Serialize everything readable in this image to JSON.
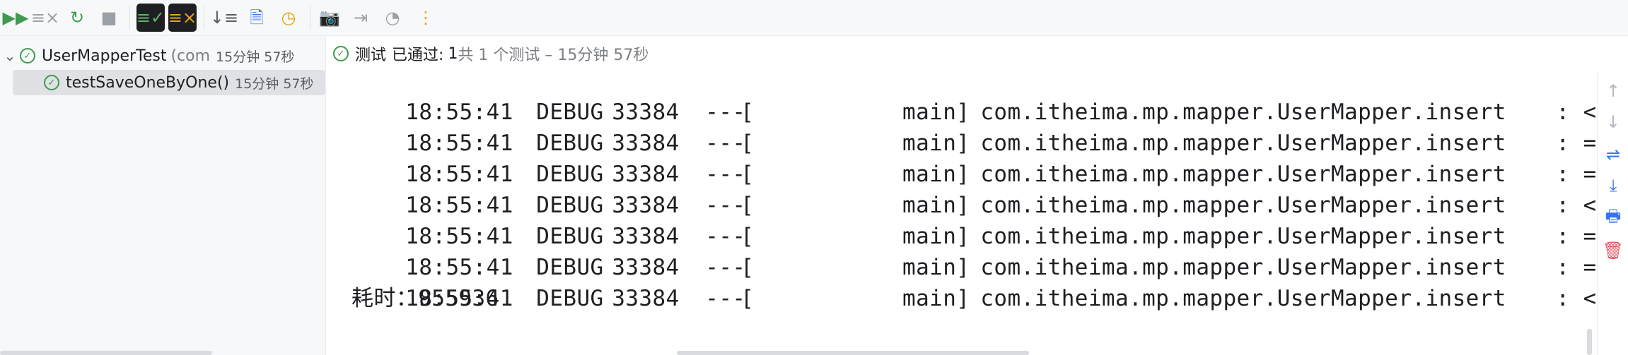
{
  "toolbar": {
    "buttons": [
      {
        "name": "rerun-icon",
        "glyph": "▶▶",
        "color": "#3f9a4e"
      },
      {
        "name": "rerun-failed-icon",
        "glyph": "≡×",
        "color": "#9aa0a6"
      },
      {
        "name": "rerun-refresh-icon",
        "glyph": "↻",
        "color": "#3f9a4e"
      },
      {
        "name": "stop-icon",
        "glyph": "■",
        "color": "#9aa0a6"
      },
      {
        "name": "show-passed-icon",
        "glyph": "≡✓",
        "color": "#5fb865"
      },
      {
        "name": "show-ignored-icon",
        "glyph": "≡×",
        "color": "#e5a50a"
      },
      {
        "name": "sort-icon",
        "glyph": "↓≡",
        "color": "#5a5d63"
      },
      {
        "name": "import-tests-icon",
        "glyph": "🗎",
        "color": "#3574f0"
      },
      {
        "name": "history-icon",
        "glyph": "◷",
        "color": "#e5a50a"
      },
      {
        "name": "screenshot-icon",
        "glyph": "📷",
        "color": "#9aa0a6"
      },
      {
        "name": "export-icon",
        "glyph": "⇥",
        "color": "#9aa0a6"
      },
      {
        "name": "coverage-icon",
        "glyph": "◔",
        "color": "#9aa0a6"
      },
      {
        "name": "more-options-icon",
        "glyph": "⋮",
        "color": "#e5a50a"
      }
    ]
  },
  "tree": {
    "root": {
      "label": "UserMapperTest",
      "package": "(com",
      "duration": "15分钟 57秒"
    },
    "child": {
      "label": "testSaveOneByOne()",
      "duration": "15分钟 57秒"
    }
  },
  "status": {
    "label": "测试",
    "state": "已通过:",
    "passed": "1",
    "summary": "共 1 个测试 – 15分钟 57秒"
  },
  "console": {
    "lines": [
      {
        "ts": "18:55:41",
        "level": "DEBUG",
        "pid": "33384",
        "dash": "---",
        "thread": "[           main]",
        "logger": "com.itheima.mp.mapper.UserMapper.insert",
        "msg": " : <=="
      },
      {
        "ts": "18:55:41",
        "level": "DEBUG",
        "pid": "33384",
        "dash": "---",
        "thread": "[           main]",
        "logger": "com.itheima.mp.mapper.UserMapper.insert",
        "msg": " : ==>  Pr"
      },
      {
        "ts": "18:55:41",
        "level": "DEBUG",
        "pid": "33384",
        "dash": "---",
        "thread": "[           main]",
        "logger": "com.itheima.mp.mapper.UserMapper.insert",
        "msg": " : ==> Par"
      },
      {
        "ts": "18:55:41",
        "level": "DEBUG",
        "pid": "33384",
        "dash": "---",
        "thread": "[           main]",
        "logger": "com.itheima.mp.mapper.UserMapper.insert",
        "msg": " : <=="
      },
      {
        "ts": "18:55:41",
        "level": "DEBUG",
        "pid": "33384",
        "dash": "---",
        "thread": "[           main]",
        "logger": "com.itheima.mp.mapper.UserMapper.insert",
        "msg": " : ==>  Pr"
      },
      {
        "ts": "18:55:41",
        "level": "DEBUG",
        "pid": "33384",
        "dash": "---",
        "thread": "[           main]",
        "logger": "com.itheima.mp.mapper.UserMapper.insert",
        "msg": " : ==> Par"
      },
      {
        "ts": "18:55:41",
        "level": "DEBUG",
        "pid": "33384",
        "dash": "---",
        "thread": "[           main]",
        "logger": "com.itheima.mp.mapper.UserMapper.insert",
        "msg": " : <=="
      }
    ],
    "elapsed": "耗时：955936"
  },
  "gutter": {
    "buttons": [
      {
        "name": "scroll-up-icon",
        "glyph": "↑",
        "color": "#b4b8bf"
      },
      {
        "name": "scroll-down-icon",
        "glyph": "↓",
        "color": "#b4b8bf"
      },
      {
        "name": "soft-wrap-icon",
        "glyph": "⇌",
        "color": "#3574f0"
      },
      {
        "name": "scroll-to-end-icon",
        "glyph": "⤓",
        "color": "#3574f0"
      },
      {
        "name": "print-icon",
        "glyph": "🖶",
        "color": "#3574f0"
      },
      {
        "name": "clear-all-icon",
        "glyph": "🗑",
        "color": "#e55765"
      }
    ]
  }
}
